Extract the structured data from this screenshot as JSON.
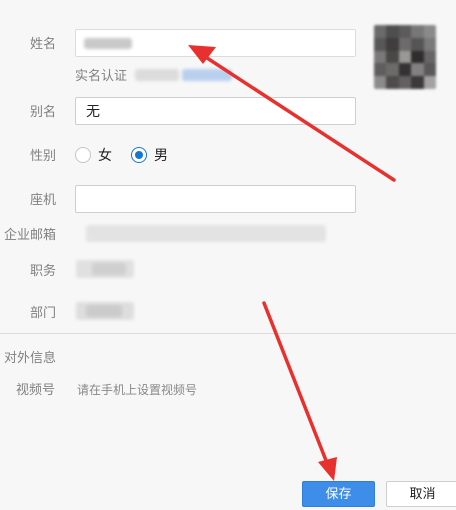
{
  "form": {
    "name": {
      "label": "姓名"
    },
    "verified": {
      "label": "实名认证"
    },
    "alias": {
      "label": "别名",
      "value": "无"
    },
    "gender": {
      "label": "性别",
      "options": [
        {
          "label": "女",
          "checked": false
        },
        {
          "label": "男",
          "checked": true
        }
      ]
    },
    "landline": {
      "label": "座机",
      "value": ""
    },
    "email": {
      "label": "企业邮箱"
    },
    "position": {
      "label": "职务"
    },
    "department": {
      "label": "部门"
    }
  },
  "external": {
    "section_title": "对外信息",
    "video_label": "视频号",
    "video_hint": "请在手机上设置视频号"
  },
  "buttons": {
    "save": "保存",
    "cancel": "取消"
  },
  "colors": {
    "primary": "#3e8de8",
    "annotation_arrow": "#e8312f",
    "radio_checked": "#1677d2"
  }
}
